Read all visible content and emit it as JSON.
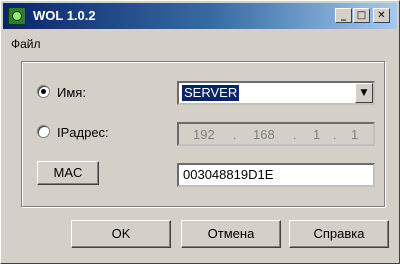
{
  "window": {
    "title": "WOL 1.0.2",
    "controls": {
      "minimize": "_",
      "maximize": "□",
      "close": "✕"
    },
    "icon": "app-icon"
  },
  "menu": {
    "file": "Файл"
  },
  "form": {
    "name_option": {
      "label": "Имя:",
      "selected": true
    },
    "ip_option": {
      "label": "IPадрес:",
      "selected": false
    },
    "name_value": "SERVER",
    "ip_octets": [
      "192",
      "168",
      "1",
      "1"
    ],
    "ip_dot": ".",
    "mac_button": "MAC",
    "mac_value": "003048819D1E"
  },
  "buttons": {
    "ok": "OK",
    "cancel": "Отмена",
    "help": "Справка"
  }
}
